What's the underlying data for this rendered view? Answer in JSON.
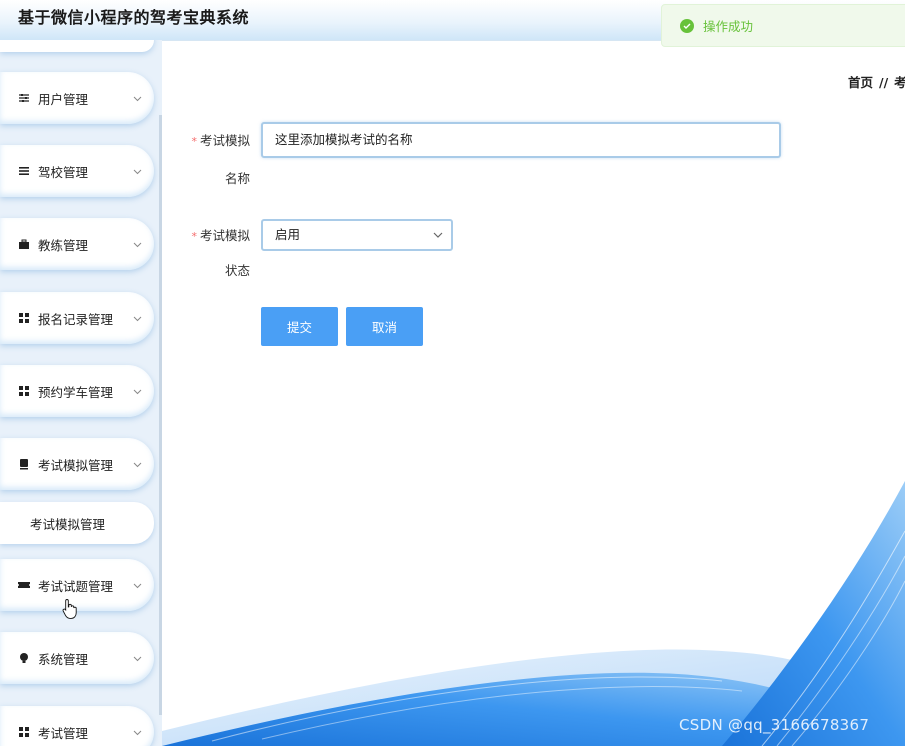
{
  "header": {
    "title": "基于微信小程序的驾考宝典系统"
  },
  "toast": {
    "message": "操作成功",
    "icon": "check-circle-icon",
    "color": "#67c23a"
  },
  "breadcrumb": {
    "home": "首页",
    "separator": "//",
    "current": "考"
  },
  "sidebar": {
    "items": [
      {
        "label": "用户管理",
        "icon": "sliders-icon"
      },
      {
        "label": "驾校管理",
        "icon": "list-icon"
      },
      {
        "label": "教练管理",
        "icon": "briefcase-icon"
      },
      {
        "label": "报名记录管理",
        "icon": "grid-icon"
      },
      {
        "label": "预约学车管理",
        "icon": "grid-icon"
      },
      {
        "label": "考试模拟管理",
        "icon": "tablet-icon"
      },
      {
        "label": "考试试题管理",
        "icon": "ticket-icon"
      },
      {
        "label": "系统管理",
        "icon": "bulb-icon"
      },
      {
        "label": "考试管理",
        "icon": "grid-icon"
      }
    ],
    "submenu": {
      "label": "考试模拟管理"
    }
  },
  "form": {
    "name_label_line1": "考试模拟",
    "name_label_line2": "名称",
    "name_value": "这里添加模拟考试的名称",
    "status_label_line1": "考试模拟",
    "status_label_line2": "状态",
    "status_value": "启用",
    "submit_label": "提交",
    "cancel_label": "取消"
  },
  "colors": {
    "primary": "#4a9ff5",
    "required": "#f56c6c",
    "success": "#67c23a"
  },
  "watermark": "CSDN @qq_3166678367"
}
